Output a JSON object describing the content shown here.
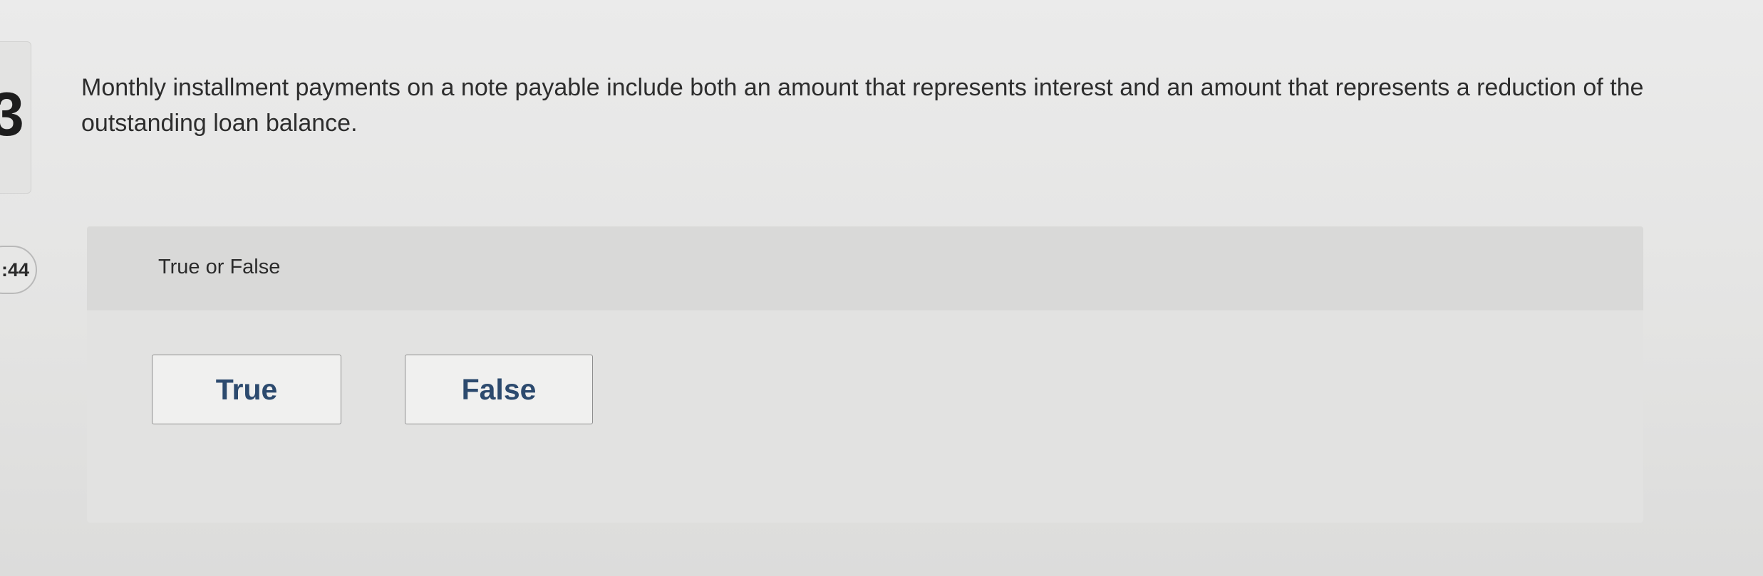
{
  "sidebar": {
    "question_number": "3",
    "timer": ":44"
  },
  "question": {
    "text": "Monthly installment payments on a note payable include both an amount that represents interest and an amount that represents a reduction of the outstanding loan balance.",
    "type_label": "True or False"
  },
  "choices": [
    {
      "label": "True"
    },
    {
      "label": "False"
    }
  ],
  "colors": {
    "button_text": "#2c4a6e",
    "button_border": "#8e8e8e",
    "background": "#e7e7e6"
  }
}
